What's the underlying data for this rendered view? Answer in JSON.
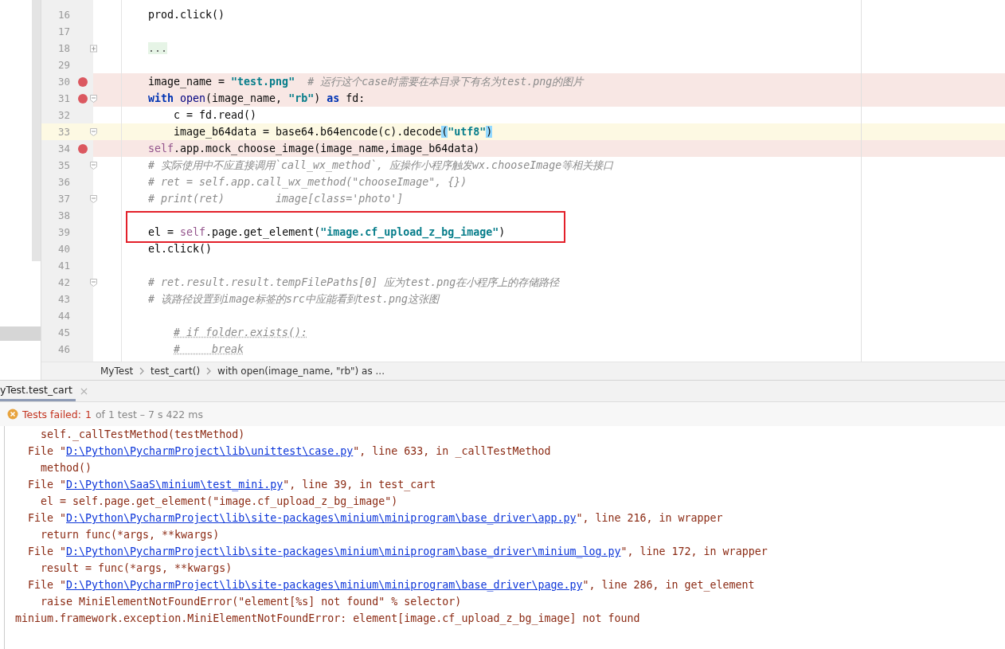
{
  "editor": {
    "lines": [
      {
        "number": "16",
        "breakpoint": false,
        "current": false,
        "foldable": false,
        "kind": "body",
        "tokens": [
          {
            "text": "prod.click()",
            "kind": "plain"
          }
        ]
      },
      {
        "number": "17",
        "breakpoint": false,
        "current": false,
        "foldable": false,
        "kind": "body"
      },
      {
        "number": "18",
        "breakpoint": false,
        "current": false,
        "foldable": true,
        "expanded": false,
        "kind": "body",
        "tokens": [
          {
            "text": "...",
            "kind": "folded"
          }
        ]
      },
      {
        "number": "29",
        "breakpoint": false,
        "current": false,
        "foldable": false,
        "kind": "body"
      },
      {
        "number": "30",
        "breakpoint": true,
        "current": false,
        "foldable": false,
        "kind": "body",
        "tokens": [
          {
            "text": "image_name = ",
            "kind": "plain"
          },
          {
            "text": "\"test.png\"",
            "kind": "string"
          },
          {
            "text": "# 运行这个case时需要在本目录下有名为test.png的图片",
            "kind": "comment"
          }
        ]
      },
      {
        "number": "31",
        "breakpoint": true,
        "current": false,
        "foldable": true,
        "expanded": true,
        "kind": "body",
        "tokens": [
          {
            "text": "with",
            "kind": "keyword"
          },
          {
            "text": "open",
            "kind": "builtin"
          },
          {
            "text": "(image_name, ",
            "kind": "plain"
          },
          {
            "text": "\"rb\"",
            "kind": "string"
          },
          {
            "text": ")",
            "kind": "plain"
          },
          {
            "text": "as",
            "kind": "keyword"
          },
          {
            "text": "fd:",
            "kind": "plain"
          }
        ]
      },
      {
        "number": "32",
        "breakpoint": false,
        "current": false,
        "foldable": false,
        "kind": "nested",
        "tokens": [
          {
            "text": "c = fd.read()",
            "kind": "plain"
          }
        ]
      },
      {
        "number": "33",
        "breakpoint": false,
        "current": true,
        "foldable": true,
        "expanded": true,
        "kind": "nested",
        "tokens": [
          {
            "text": "image_b64data = base64.b64encode(c).decode",
            "kind": "plain"
          },
          {
            "text": "(",
            "kind": "brace_match"
          },
          {
            "text": "\"utf8\"",
            "kind": "string"
          },
          {
            "text": ")",
            "kind": "brace_match"
          }
        ]
      },
      {
        "number": "34",
        "breakpoint": true,
        "current": false,
        "foldable": false,
        "kind": "body",
        "tokens": [
          {
            "text": "self",
            "kind": "self"
          },
          {
            "text": ".app.mock_choose_image(image_name,image_b64data)",
            "kind": "plain"
          }
        ]
      },
      {
        "number": "35",
        "breakpoint": false,
        "current": false,
        "foldable": true,
        "expanded": true,
        "kind": "body",
        "tokens": [
          {
            "text": "# 实际使用中不应直接调用`call_wx_method`, 应操作小程序触发wx.chooseImage等相关接口",
            "kind": "comment"
          }
        ]
      },
      {
        "number": "36",
        "breakpoint": false,
        "current": false,
        "foldable": false,
        "kind": "body",
        "tokens": [
          {
            "text": "# ret = self.app.call_wx_method(\"chooseImage\", {})",
            "kind": "comment"
          }
        ]
      },
      {
        "number": "37",
        "breakpoint": false,
        "current": false,
        "foldable": true,
        "expanded": true,
        "kind": "body",
        "tokens": [
          {
            "text": "# print(ret)        image[class='photo']",
            "kind": "comment"
          }
        ]
      },
      {
        "number": "38",
        "breakpoint": false,
        "current": false,
        "foldable": false,
        "kind": "body"
      },
      {
        "number": "39",
        "breakpoint": false,
        "current": false,
        "foldable": false,
        "kind": "body",
        "tokens": [
          {
            "text": "el = ",
            "kind": "plain"
          },
          {
            "text": "self",
            "kind": "self"
          },
          {
            "text": ".page.get_element(",
            "kind": "plain"
          },
          {
            "text": "\"image.cf_upload_z_bg_image\"",
            "kind": "string"
          },
          {
            "text": ")",
            "kind": "plain"
          }
        ]
      },
      {
        "number": "40",
        "breakpoint": false,
        "current": false,
        "foldable": false,
        "kind": "body",
        "tokens": [
          {
            "text": "el.click()",
            "kind": "plain"
          }
        ]
      },
      {
        "number": "41",
        "breakpoint": false,
        "current": false,
        "foldable": false,
        "kind": "body"
      },
      {
        "number": "42",
        "breakpoint": false,
        "current": false,
        "foldable": true,
        "expanded": true,
        "kind": "body",
        "tokens": [
          {
            "text": "# ret.result.result.tempFilePaths[0] 应为test.png在小程序上的存储路径",
            "kind": "comment"
          }
        ]
      },
      {
        "number": "43",
        "breakpoint": false,
        "current": false,
        "foldable": false,
        "kind": "body",
        "tokens": [
          {
            "text": "# 该路径设置到image标签的src中应能看到test.png这张图",
            "kind": "comment"
          }
        ]
      },
      {
        "number": "44",
        "breakpoint": false,
        "current": false,
        "foldable": false,
        "kind": "body"
      },
      {
        "number": "45",
        "breakpoint": false,
        "current": false,
        "foldable": false,
        "kind": "nested",
        "tokens": [
          {
            "text": "# if folder.exists():",
            "kind": "comment_typo"
          }
        ]
      },
      {
        "number": "46",
        "breakpoint": false,
        "current": false,
        "foldable": false,
        "kind": "nested",
        "tokens": [
          {
            "text": "#     break",
            "kind": "comment_typo"
          }
        ]
      }
    ],
    "breadcrumbs": [
      "MyTest",
      "test_cart()",
      "with open(image_name, \"rb\") as ..."
    ]
  },
  "run_panel": {
    "tab": {
      "label": "yTest.test_cart",
      "selected": true
    },
    "status": {
      "label": "Tests failed:",
      "failed": "1",
      "detail": "of 1 test – 7 s 422 ms"
    },
    "console": [
      {
        "kind": "source",
        "tokens": [
          {
            "text": "self._callTestMethod(testMethod)",
            "kind": "plain"
          }
        ]
      },
      {
        "kind": "frame",
        "tokens": [
          {
            "text": "File \"",
            "kind": "plain"
          },
          {
            "text": "D:\\Python\\PycharmProject\\lib\\unittest\\case.py",
            "kind": "link"
          },
          {
            "text": "\", line 633, in _callTestMethod",
            "kind": "plain"
          }
        ]
      },
      {
        "kind": "source",
        "tokens": [
          {
            "text": "method()",
            "kind": "plain"
          }
        ]
      },
      {
        "kind": "frame",
        "tokens": [
          {
            "text": "File \"",
            "kind": "plain"
          },
          {
            "text": "D:\\Python\\SaaS\\minium\\test_mini.py",
            "kind": "link"
          },
          {
            "text": "\", line 39, in test_cart",
            "kind": "plain"
          }
        ]
      },
      {
        "kind": "source",
        "tokens": [
          {
            "text": "el = self.page.get_element(\"image.cf_upload_z_bg_image\")",
            "kind": "plain"
          }
        ]
      },
      {
        "kind": "frame",
        "tokens": [
          {
            "text": "File \"",
            "kind": "plain"
          },
          {
            "text": "D:\\Python\\PycharmProject\\lib\\site-packages\\minium\\miniprogram\\base_driver\\app.py",
            "kind": "link"
          },
          {
            "text": "\", line 216, in wrapper",
            "kind": "plain"
          }
        ]
      },
      {
        "kind": "source",
        "tokens": [
          {
            "text": "return func(*args, **kwargs)",
            "kind": "plain"
          }
        ]
      },
      {
        "kind": "frame",
        "tokens": [
          {
            "text": "File \"",
            "kind": "plain"
          },
          {
            "text": "D:\\Python\\PycharmProject\\lib\\site-packages\\minium\\miniprogram\\base_driver\\minium_log.py",
            "kind": "link"
          },
          {
            "text": "\", line 172, in wrapper",
            "kind": "plain"
          }
        ]
      },
      {
        "kind": "source",
        "tokens": [
          {
            "text": "result = func(*args, **kwargs)",
            "kind": "plain"
          }
        ]
      },
      {
        "kind": "frame",
        "tokens": [
          {
            "text": "File \"",
            "kind": "plain"
          },
          {
            "text": "D:\\Python\\PycharmProject\\lib\\site-packages\\minium\\miniprogram\\base_driver\\page.py",
            "kind": "link"
          },
          {
            "text": "\", line 286, in get_element",
            "kind": "plain"
          }
        ]
      },
      {
        "kind": "source",
        "tokens": [
          {
            "text": "raise MiniElementNotFoundError(\"element[%s] not found\" % selector)",
            "kind": "plain"
          }
        ]
      },
      {
        "kind": "error",
        "tokens": [
          {
            "text": "minium.framework.exception.MiniElementNotFoundError: element[image.cf_upload_z_bg_image] not found",
            "kind": "plain"
          }
        ]
      }
    ]
  }
}
